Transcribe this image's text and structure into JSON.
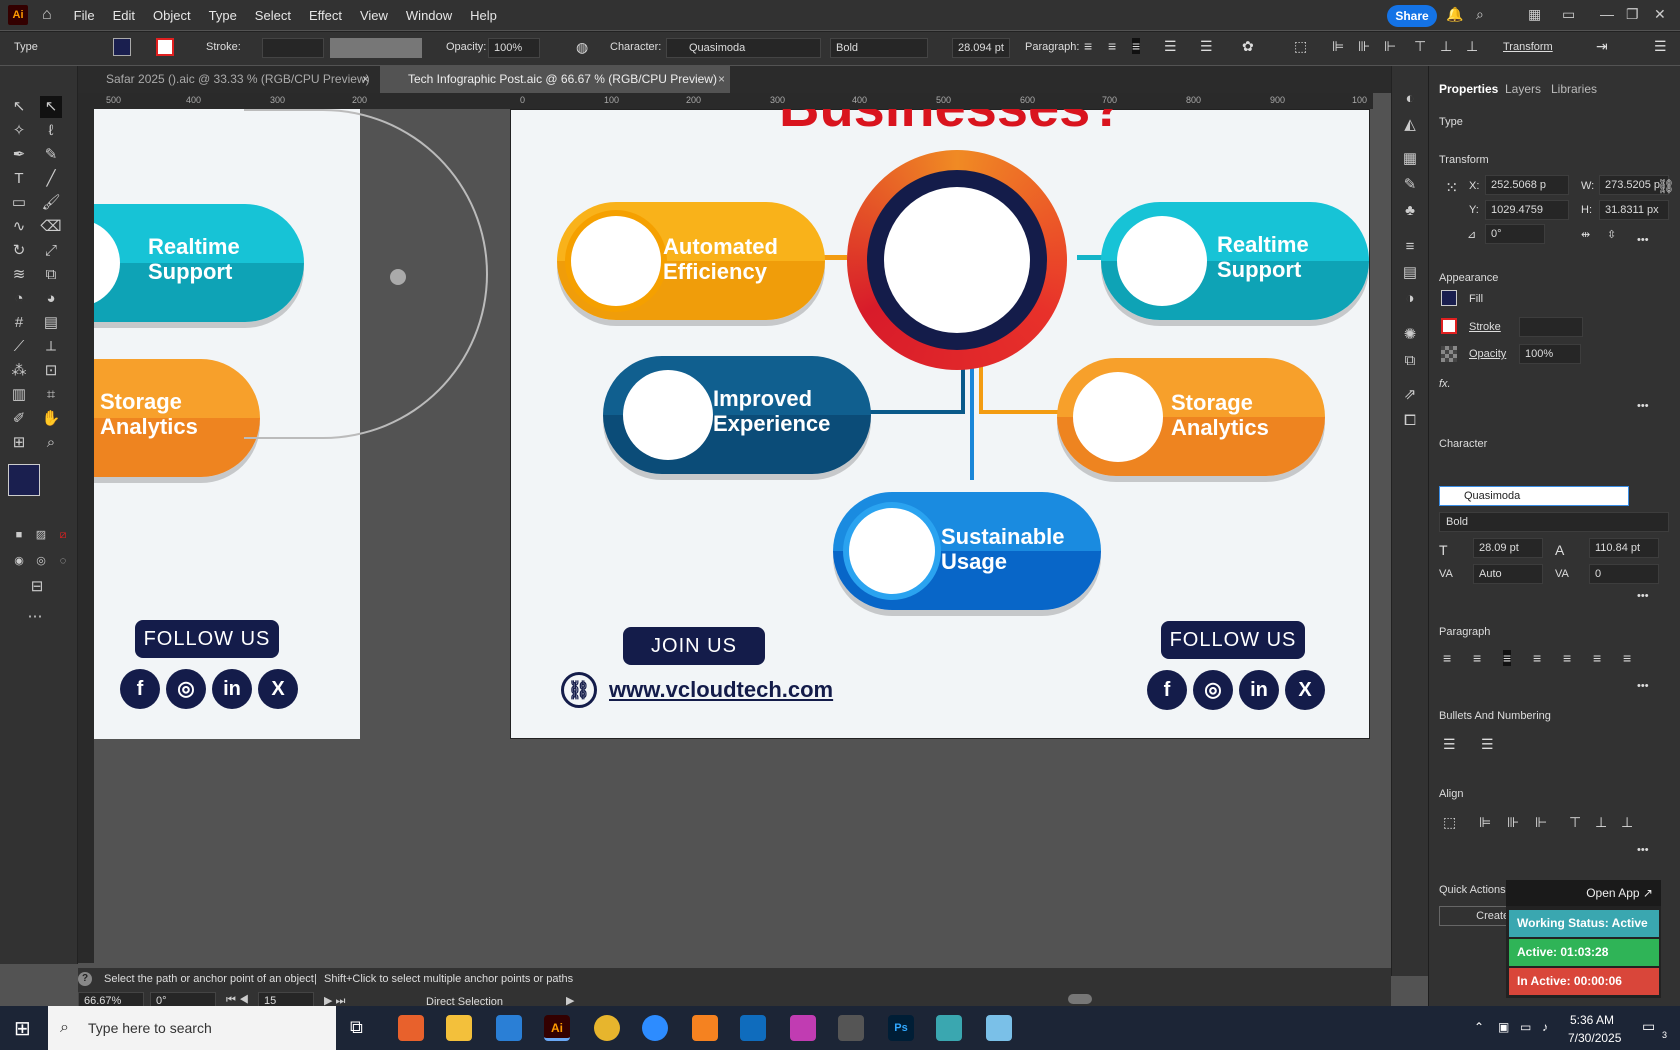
{
  "app": {
    "logo": "Ai",
    "name": "Adobe Illustrator"
  },
  "menu": [
    "File",
    "Edit",
    "Object",
    "Type",
    "Select",
    "Effect",
    "View",
    "Window",
    "Help"
  ],
  "share_label": "Share",
  "control": {
    "mode": "Type",
    "stroke_label": "Stroke:",
    "opacity_label": "Opacity:",
    "opacity": "100%",
    "character_label": "Character:",
    "font": "Quasimoda",
    "weight": "Bold",
    "size": "28.094 pt",
    "paragraph_label": "Paragraph:",
    "transform_label": "Transform"
  },
  "tabs": [
    {
      "label": "Safar 2025 ().aic @ 33.33 % (RGB/CPU Preview)"
    },
    {
      "label": "Tech Infographic Post.aic @ 66.67 % (RGB/CPU Preview)"
    }
  ],
  "ruler_h": [
    "500",
    "400",
    "300",
    "200",
    "0",
    "100",
    "200",
    "300",
    "400",
    "500",
    "600",
    "700",
    "800",
    "900",
    "100"
  ],
  "panel": {
    "tabs": [
      "Properties",
      "Layers",
      "Libraries"
    ],
    "type_section": "Type",
    "transform": {
      "title": "Transform",
      "x_label": "X:",
      "x": "252.5068 p",
      "y_label": "Y:",
      "y": "1029.4759",
      "w_label": "W:",
      "w": "273.5205 p",
      "h_label": "H:",
      "h": "31.8311 px",
      "angle": "0°"
    },
    "appearance": {
      "title": "Appearance",
      "fill": "Fill",
      "stroke": "Stroke",
      "opacity_label": "Opacity",
      "opacity": "100%",
      "fx": "fx."
    },
    "character": {
      "title": "Character",
      "font": "Quasimoda",
      "weight": "Bold",
      "size": "28.09 pt",
      "leading": "110.84 pt",
      "kerning": "Auto",
      "tracking": "0"
    },
    "paragraph": {
      "title": "Paragraph"
    },
    "bullets": {
      "title": "Bullets And Numbering"
    },
    "align": {
      "title": "Align"
    },
    "quick": {
      "title": "Quick Actions",
      "button": "Create Ou"
    }
  },
  "floating": {
    "open_app": "Open App ↗",
    "working": "Working Status: Active",
    "active": "Active: 01:03:28",
    "inactive": "In Active: 00:00:06"
  },
  "status": {
    "hint1": "Select the path or anchor point of an object",
    "hint2": "Shift+Click to select multiple anchor points or paths",
    "zoom": "66.67%",
    "angle": "0°",
    "artboard": "15",
    "tool": "Direct Selection"
  },
  "artwork": {
    "title_fragment": "Businesses?",
    "pills": {
      "automated": [
        "Automated",
        "Efficiency"
      ],
      "realtime": [
        "Realtime",
        "Support"
      ],
      "improved": [
        "Improved",
        "Experience"
      ],
      "storage": [
        "Storage",
        "Analytics"
      ],
      "sustainable": [
        "Sustainable",
        "Usage"
      ]
    },
    "follow": "FOLLOW US",
    "join": "JOIN US",
    "url": "www.vcloudtech.com",
    "social": [
      "f",
      "◎",
      "in",
      "X"
    ]
  },
  "taskbar": {
    "search": "Type here to search",
    "time": "5:36 AM",
    "date": "7/30/2025",
    "notif": "3"
  },
  "colors": {
    "accent": "#1473e6",
    "orange": "#f39c12",
    "teal": "#14b4c8",
    "navy": "#141c4a",
    "red": "#e02020",
    "blue": "#0a5a8a"
  }
}
